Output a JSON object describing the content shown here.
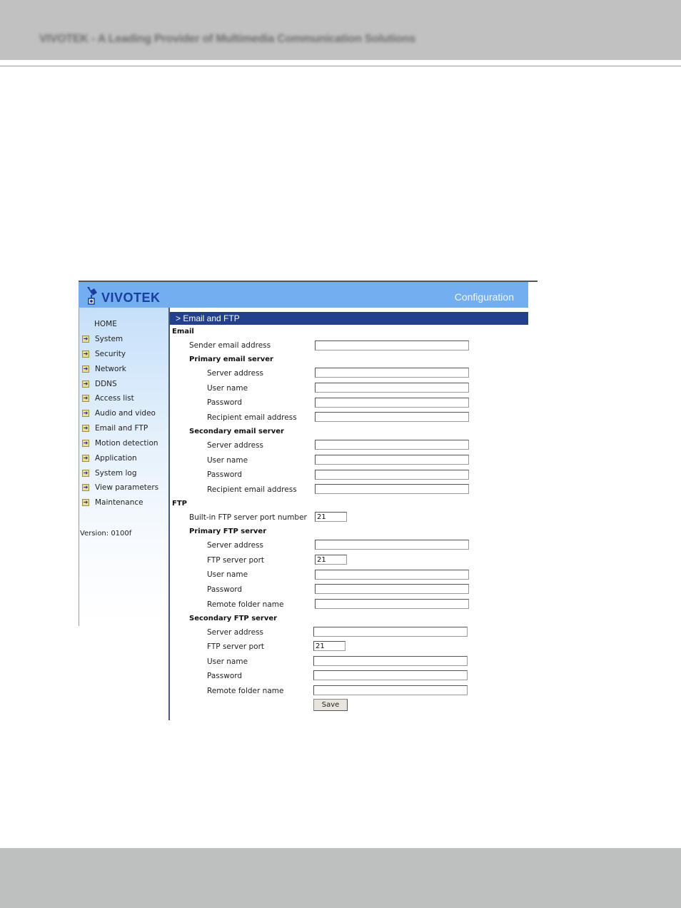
{
  "page_header": {
    "text": "VIVOTEK - A Leading Provider of Multimedia Communication Solutions"
  },
  "app": {
    "brand": "VIVOTEK",
    "title": "Configuration",
    "breadcrumb": "> Email and FTP"
  },
  "sidebar": {
    "home": "HOME",
    "items": [
      {
        "label": "System"
      },
      {
        "label": "Security"
      },
      {
        "label": "Network"
      },
      {
        "label": "DDNS"
      },
      {
        "label": "Access list"
      },
      {
        "label": "Audio and video"
      },
      {
        "label": "Email and FTP"
      },
      {
        "label": "Motion detection"
      },
      {
        "label": "Application"
      },
      {
        "label": "System log"
      },
      {
        "label": "View parameters"
      },
      {
        "label": "Maintenance"
      }
    ],
    "version": "Version: 0100f"
  },
  "form": {
    "email": {
      "title": "Email",
      "sender_label": "Sender email address",
      "sender_value": "",
      "primary": {
        "title": "Primary email server",
        "server_label": "Server address",
        "server_value": "",
        "user_label": "User name",
        "user_value": "",
        "password_label": "Password",
        "password_value": "",
        "recipient_label": "Recipient email address",
        "recipient_value": ""
      },
      "secondary": {
        "title": "Secondary email server",
        "server_label": "Server address",
        "server_value": "",
        "user_label": "User name",
        "user_value": "",
        "password_label": "Password",
        "password_value": "",
        "recipient_label": "Recipient email address",
        "recipient_value": ""
      }
    },
    "ftp": {
      "title": "FTP",
      "builtin_port_label": "Built-in FTP server port number",
      "builtin_port_value": "21",
      "primary": {
        "title": "Primary FTP server",
        "server_label": "Server address",
        "server_value": "",
        "port_label": "FTP server port",
        "port_value": "21",
        "user_label": "User name",
        "user_value": "",
        "password_label": "Password",
        "password_value": "",
        "folder_label": "Remote folder name",
        "folder_value": ""
      },
      "secondary": {
        "title": "Secondary FTP server",
        "server_label": "Server address",
        "server_value": "",
        "port_label": "FTP server port",
        "port_value": "21",
        "user_label": "User name",
        "user_value": "",
        "password_label": "Password",
        "password_value": "",
        "folder_label": "Remote folder name",
        "folder_value": ""
      }
    },
    "save_label": "Save"
  },
  "colors": {
    "banner": "#72aef0",
    "breadcrumb_bar": "#23408c",
    "brand_text": "#1a3f9c",
    "page_band": "#c0c1c0"
  }
}
